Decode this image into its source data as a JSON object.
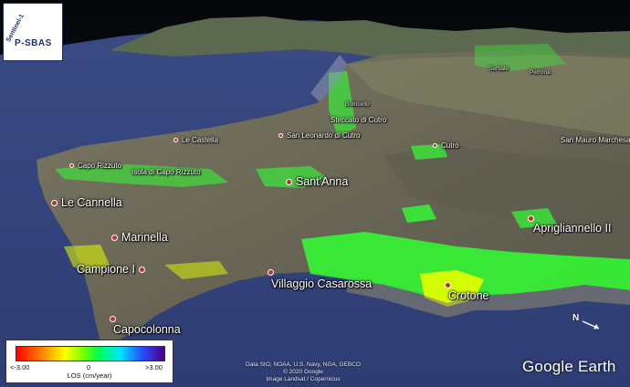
{
  "logo": {
    "top_text": "Sentinel-1",
    "main_text": "P-SBAS"
  },
  "places_major": [
    {
      "id": "sant-anna",
      "label": "Sant'Anna"
    },
    {
      "id": "le-cannella",
      "label": "Le Cannella"
    },
    {
      "id": "marinella",
      "label": "Marinella"
    },
    {
      "id": "campione",
      "label": "Campione I"
    },
    {
      "id": "villaggio-casarossa",
      "label": "Villaggio Casarossa"
    },
    {
      "id": "crotone",
      "label": "Crotone"
    },
    {
      "id": "capocolonna",
      "label": "Capocolonna"
    },
    {
      "id": "aprigliano",
      "label": "Aprigliannello II"
    }
  ],
  "places_minor": [
    {
      "id": "capo-rizzuto",
      "label": "Capo Rizzuto"
    },
    {
      "id": "isola",
      "label": "Isola di Capo Rizzuto"
    },
    {
      "id": "le-castella",
      "label": "Le Castella"
    },
    {
      "id": "san-leonardo",
      "label": "San Leonardo di Cutro"
    },
    {
      "id": "cutro",
      "label": "Cutro"
    },
    {
      "id": "steccato",
      "label": "Steccato di Cutro"
    },
    {
      "id": "san-mauro",
      "label": "San Mauro Marchesato"
    }
  ],
  "places_tiny": [
    {
      "id": "botricello",
      "label": "Botricello"
    },
    {
      "id": "sersale",
      "label": "Sersale"
    },
    {
      "id": "petrona",
      "label": "Petronà"
    }
  ],
  "legend": {
    "min_label": "<-3.00",
    "mid_label": "0",
    "max_label": ">3.00",
    "title": "LOS (cm/year)"
  },
  "credits": [
    "Data SIO, NOAA, U.S. Navy, NGA, GEBCO",
    "© 2020 Google",
    "Image Landsat / Copernicus"
  ],
  "brand": "Google Earth",
  "north_label": "N",
  "colors": {
    "sea": "#3d4f86",
    "land": "#6b6a58",
    "deformation_green": "#33ff33",
    "uplift_yellow": "#e6ff00"
  }
}
